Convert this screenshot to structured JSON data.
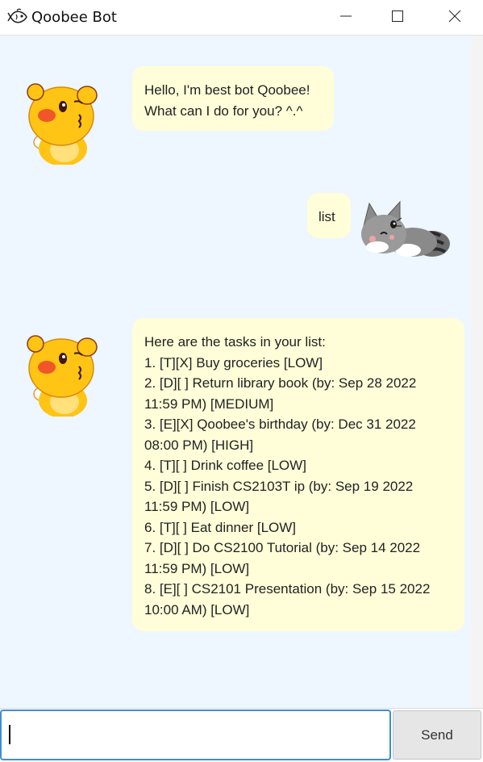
{
  "window": {
    "title": "Qoobee Bot",
    "icon": "fish-icon"
  },
  "colors": {
    "chat_background": "#eef6ff",
    "bubble_background": "#fffed9",
    "input_focus_border": "#3d8fd6",
    "send_button_background": "#e6e6e6"
  },
  "messages": [
    {
      "sender": "bot",
      "avatar": "qoobee-avatar",
      "lines": [
        "Hello, I'm best bot Qoobee!",
        "What can I do for you? ^.^"
      ]
    },
    {
      "sender": "user",
      "avatar": "cat-avatar",
      "lines": [
        "list"
      ]
    },
    {
      "sender": "bot",
      "avatar": "qoobee-avatar",
      "lines": [
        "Here are the tasks in your list:",
        "1. [T][X] Buy groceries [LOW]",
        "2. [D][ ] Return library book (by: Sep 28 2022",
        "11:59 PM) [MEDIUM]",
        "3. [E][X] Qoobee's birthday (by: Dec 31 2022",
        "08:00 PM) [HIGH]",
        "4. [T][ ] Drink coffee [LOW]",
        "5. [D][ ] Finish CS2103T ip (by: Sep 19 2022",
        "11:59 PM) [LOW]",
        "6. [T][ ] Eat dinner [LOW]",
        "7. [D][ ] Do CS2100 Tutorial (by: Sep 14 2022",
        "11:59 PM) [LOW]",
        "8. [E][ ] CS2101 Presentation (by: Sep 15 2022",
        "10:00 AM) [LOW]"
      ]
    }
  ],
  "input": {
    "value": "",
    "placeholder": ""
  },
  "send_label": "Send"
}
